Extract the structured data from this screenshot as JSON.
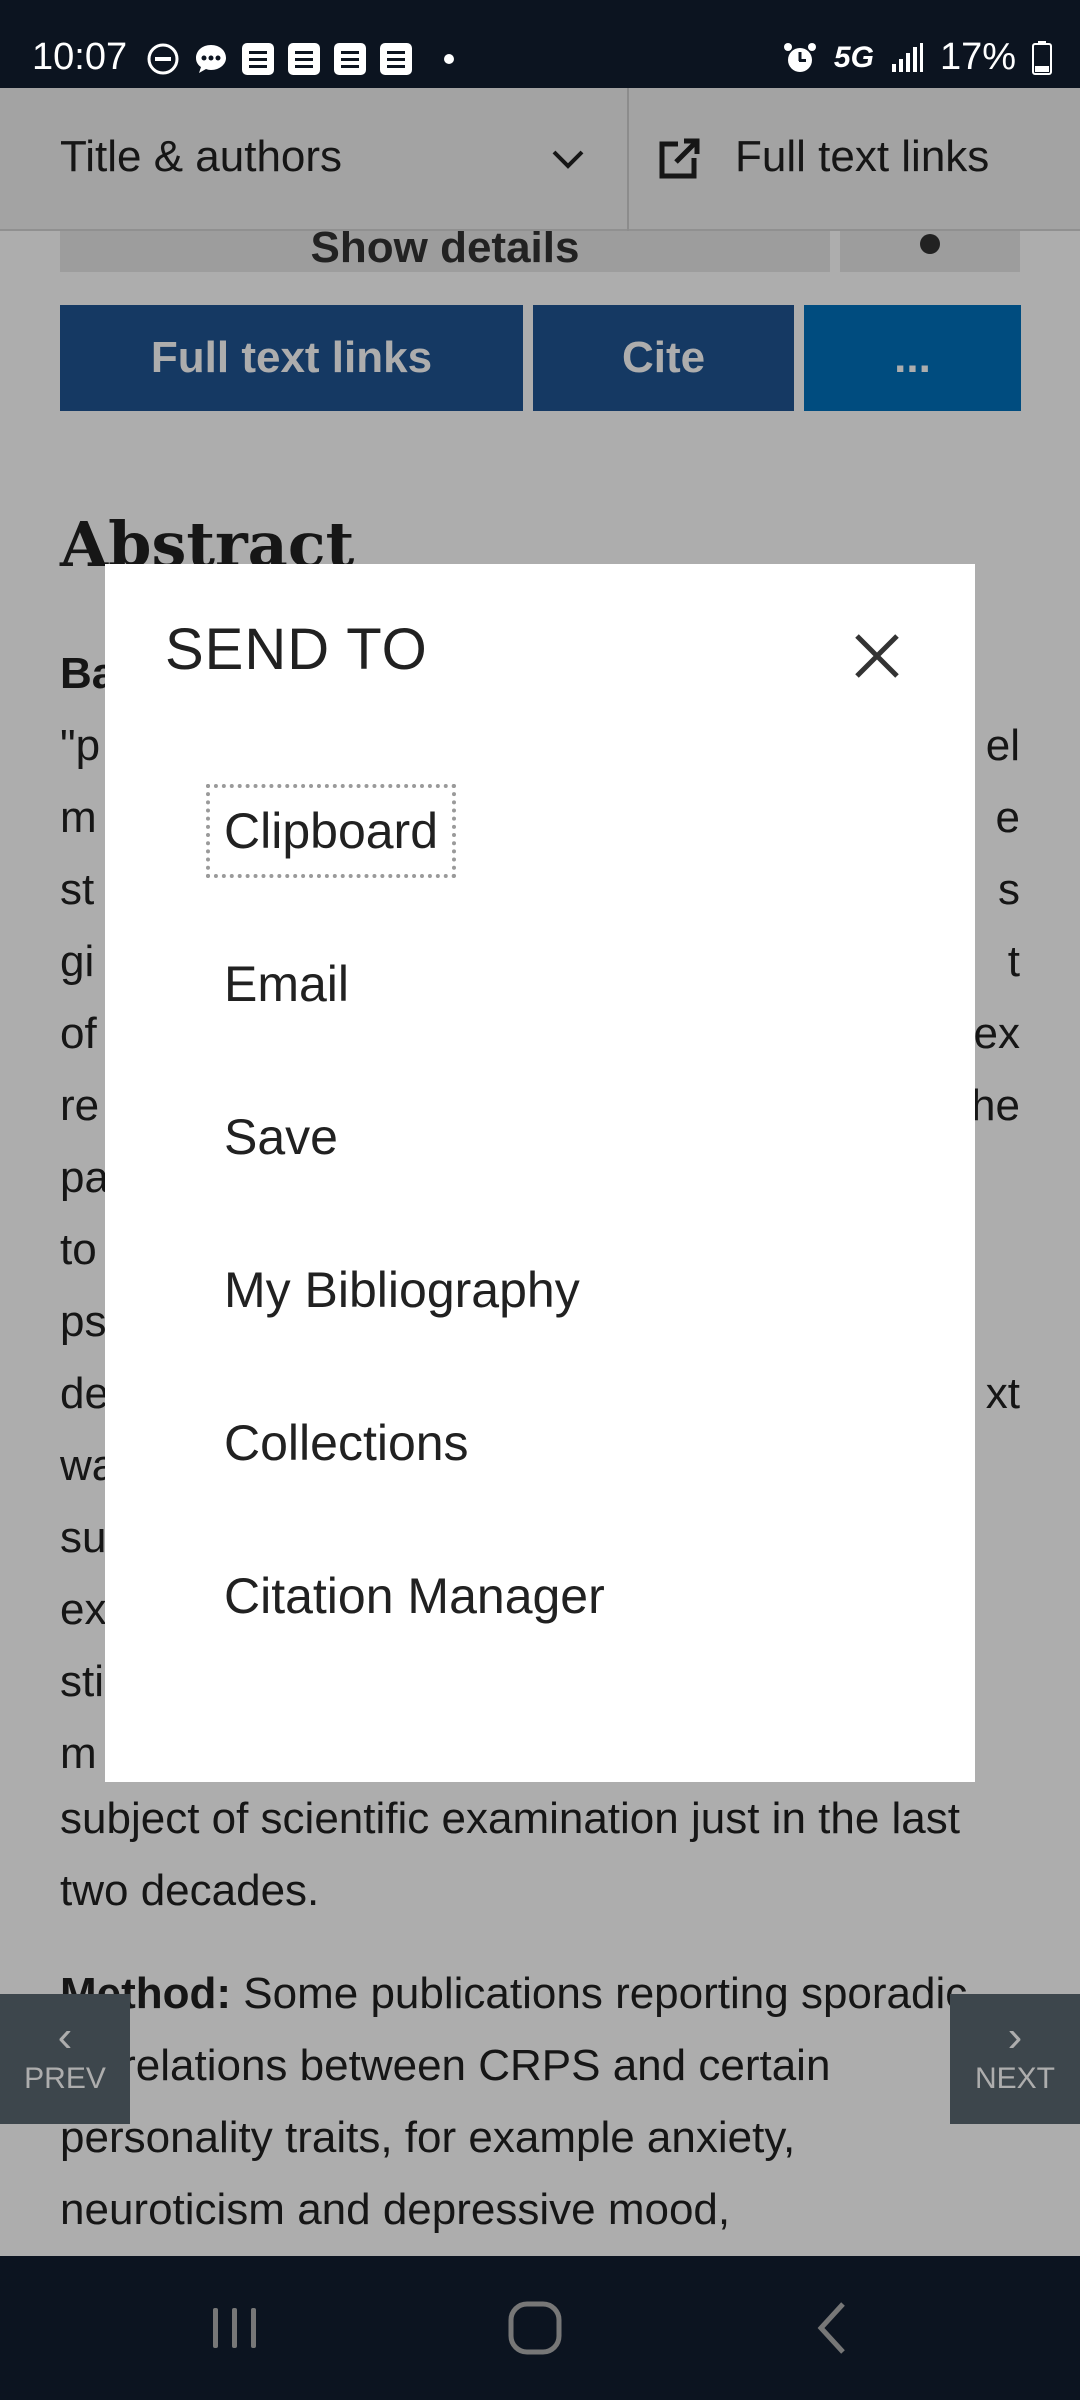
{
  "status_bar": {
    "time": "10:07",
    "network": "5G",
    "battery": "17%",
    "left_icons": [
      "do-not-disturb-icon",
      "chat-icon",
      "notes-icon",
      "notes-icon",
      "notes-icon",
      "notes-icon",
      "dot-icon"
    ],
    "right_icons": [
      "alarm-icon",
      "signal-icon",
      "battery-icon"
    ]
  },
  "header": {
    "title": "Title & authors",
    "full_text_link": "Full text links"
  },
  "page": {
    "show_details": "Show details",
    "buttons": {
      "full_text_links": "Full text links",
      "cite": "Cite",
      "more": "..."
    },
    "abstract_heading": "Abstract",
    "abstract_fragment_lines": [
      "Ba",
      "\"p",
      "m",
      "st",
      "gi",
      "of",
      "re",
      "pa",
      "to",
      "ps",
      "de",
      "wa",
      "su",
      "ex",
      "sti",
      "m"
    ],
    "abstract_right_fragments": [
      "el",
      "e",
      "s",
      "t",
      "ex",
      "he",
      "",
      "",
      "",
      "xt"
    ],
    "abstract_tail": "subject of scientific examination just in the last two decades.",
    "method_label": "Method:",
    "method_text": "Some publications reporting sporadic correlations between CRPS and certain personality traits, for example anxiety, neuroticism and depressive mood,"
  },
  "pager": {
    "prev": "PREV",
    "next": "NEXT"
  },
  "modal": {
    "title": "SEND TO",
    "items": [
      "Clipboard",
      "Email",
      "Save",
      "My Bibliography",
      "Collections",
      "Citation Manager"
    ]
  }
}
